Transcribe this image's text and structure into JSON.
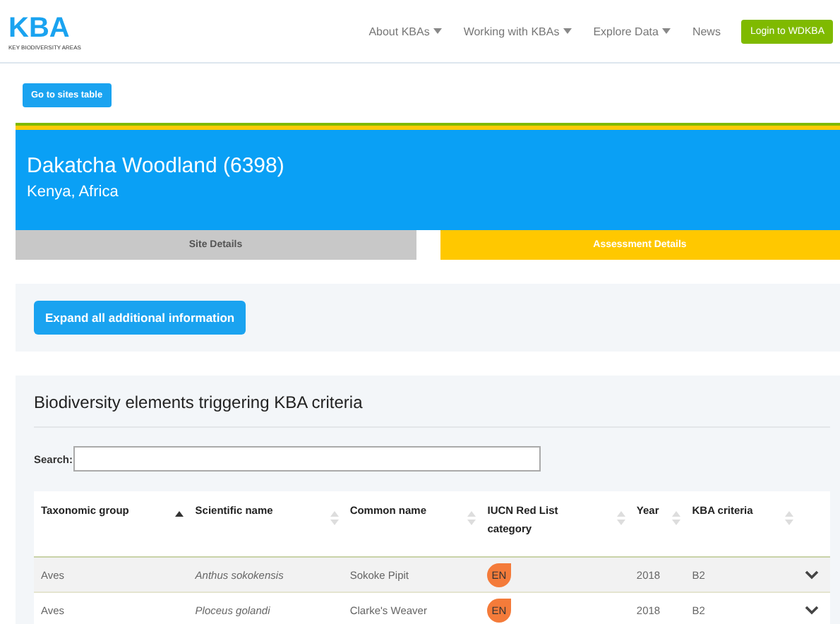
{
  "logo": {
    "text": "KBA",
    "subtitle": "KEY BIODIVERSITY AREAS"
  },
  "nav": [
    {
      "label": "About KBAs",
      "dropdown": true
    },
    {
      "label": "Working with KBAs",
      "dropdown": true
    },
    {
      "label": "Explore Data",
      "dropdown": true
    },
    {
      "label": "News",
      "dropdown": false
    }
  ],
  "login_button": "Login to WDKBA",
  "back_button": "Go to sites table",
  "site": {
    "title": "Dakatcha Woodland (6398)",
    "location": "Kenya, Africa"
  },
  "tabs": [
    {
      "label": "Site Details",
      "selected": false
    },
    {
      "label": "Assessment Details",
      "selected": true
    }
  ],
  "expand_button": "Expand all additional information",
  "section": {
    "title": "Biodiversity elements triggering KBA criteria",
    "search_label": "Search:",
    "table": {
      "columns": [
        {
          "label": "Taxonomic group",
          "sorted": true
        },
        {
          "label": "Scientific name",
          "sorted": false
        },
        {
          "label": "Common name",
          "sorted": false
        },
        {
          "label": "IUCN Red List category",
          "sorted": false
        },
        {
          "label": "Year",
          "sorted": false
        },
        {
          "label": "KBA criteria",
          "sorted": false
        }
      ],
      "rows": [
        {
          "group": "Aves",
          "scientific": "Anthus sokokensis",
          "common": "Sokoke Pipit",
          "category": "EN",
          "color": "#f47b3a",
          "year": "2018",
          "criteria": "B2"
        },
        {
          "group": "Aves",
          "scientific": "Ploceus golandi",
          "common": "Clarke's Weaver",
          "category": "EN",
          "color": "#f47b3a",
          "year": "2018",
          "criteria": "B2"
        }
      ]
    }
  }
}
